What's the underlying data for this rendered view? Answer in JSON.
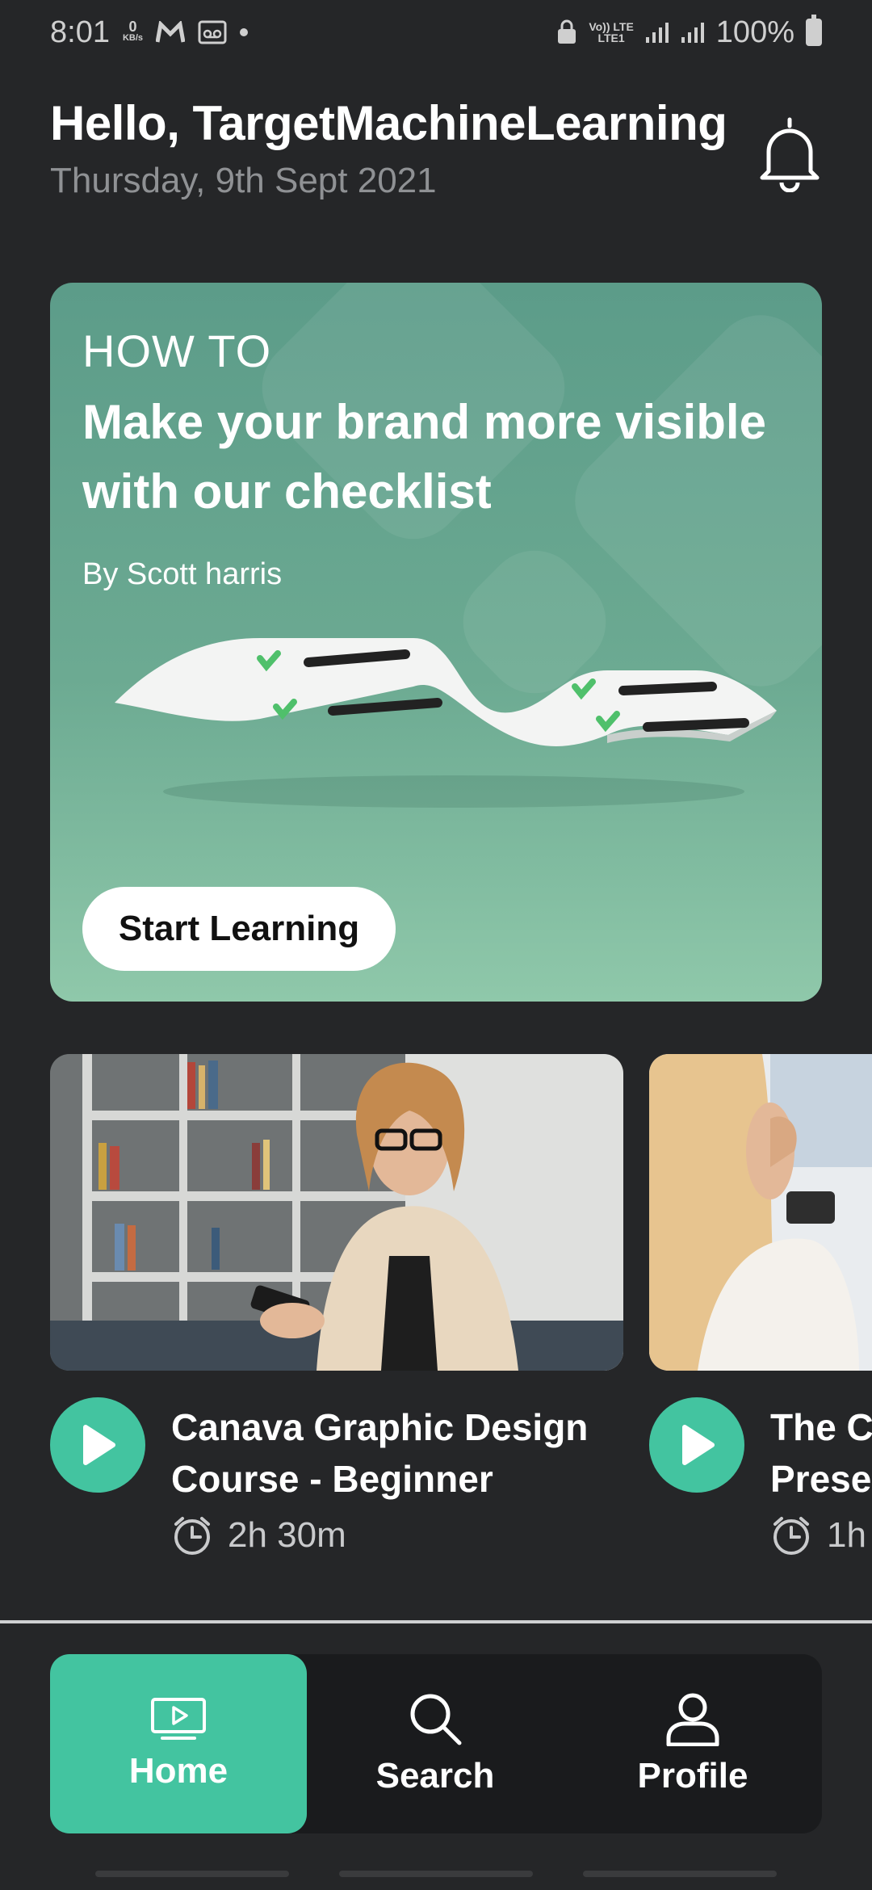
{
  "status_bar": {
    "time": "8:01",
    "net_speed_value": "0",
    "net_speed_unit": "KB/s",
    "carrier_line1": "Vo)) LTE",
    "carrier_line2": "LTE1",
    "battery": "100%"
  },
  "header": {
    "greeting": "Hello, TargetMachineLearning",
    "date": "Thursday, 9th Sept 2021"
  },
  "featured": {
    "kicker": "HOW TO",
    "title": "Make your brand more visible with our checklist",
    "author": "By Scott harris",
    "cta": "Start Learning"
  },
  "courses": [
    {
      "title_line1": "Canava Graphic Design",
      "title_line2": "Course - Beginner",
      "duration": "2h 30m"
    },
    {
      "title_line1": "The Co",
      "title_line2": "Presen",
      "duration": "1h"
    }
  ],
  "nav": {
    "home": "Home",
    "search": "Search",
    "profile": "Profile"
  },
  "colors": {
    "accent": "#43c4a0",
    "background": "#252628",
    "card": "#6caa92"
  }
}
